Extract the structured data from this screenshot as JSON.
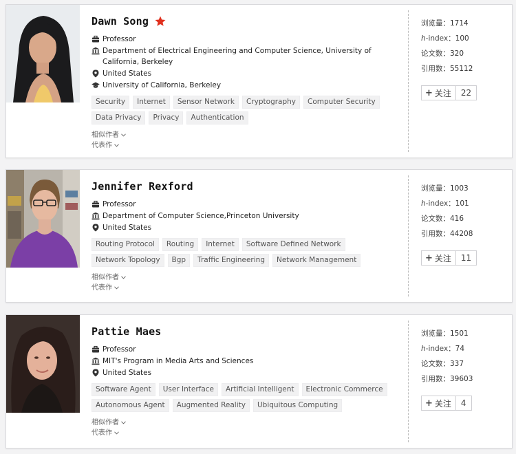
{
  "scholars": [
    {
      "name": "Dawn Song",
      "starred": true,
      "position": "Professor",
      "affiliation": "Department of Electrical Engineering and Computer Science, University of California, Berkeley",
      "location": "United States",
      "education": "University of California, Berkeley",
      "tags": [
        "Security",
        "Internet",
        "Sensor Network",
        "Cryptography",
        "Computer Security",
        "Data Privacy",
        "Privacy",
        "Authentication"
      ],
      "similar_label": "相似作者",
      "works_label": "代表作",
      "stats": {
        "views_label": "浏览量：",
        "views": "1714",
        "hindex_label_italic": "h",
        "hindex_label_rest": "-index：",
        "hindex": "100",
        "papers_label": "论文数：",
        "papers": "320",
        "citations_label": "引用数：",
        "citations": "55112"
      },
      "follow_label": "关注",
      "follow_count": "22"
    },
    {
      "name": "Jennifer Rexford",
      "starred": false,
      "position": "Professor",
      "affiliation": "Department of Computer Science,Princeton University",
      "location": "United States",
      "education": "",
      "tags": [
        "Routing Protocol",
        "Routing",
        "Internet",
        "Software Defined Network",
        "Network Topology",
        "Bgp",
        "Traffic Engineering",
        "Network Management"
      ],
      "similar_label": "相似作者",
      "works_label": "代表作",
      "stats": {
        "views_label": "浏览量：",
        "views": "1003",
        "hindex_label_italic": "h",
        "hindex_label_rest": "-index：",
        "hindex": "101",
        "papers_label": "论文数：",
        "papers": "416",
        "citations_label": "引用数：",
        "citations": "44208"
      },
      "follow_label": "关注",
      "follow_count": "11"
    },
    {
      "name": "Pattie Maes",
      "starred": false,
      "position": "Professor",
      "affiliation": "MIT's Program in Media Arts and Sciences",
      "location": "United States",
      "education": "",
      "tags": [
        "Software Agent",
        "User Interface",
        "Artificial Intelligent",
        "Electronic Commerce",
        "Autonomous Agent",
        "Augmented Reality",
        "Ubiquitous Computing"
      ],
      "similar_label": "相似作者",
      "works_label": "代表作",
      "stats": {
        "views_label": "浏览量：",
        "views": "1501",
        "hindex_label_italic": "h",
        "hindex_label_rest": "-index：",
        "hindex": "74",
        "papers_label": "论文数：",
        "papers": "337",
        "citations_label": "引用数：",
        "citations": "39603"
      },
      "follow_label": "关注",
      "follow_count": "4"
    }
  ],
  "colors": {
    "star": "#e0301e",
    "text": "#222222",
    "tag_bg": "#f1f1f2"
  }
}
